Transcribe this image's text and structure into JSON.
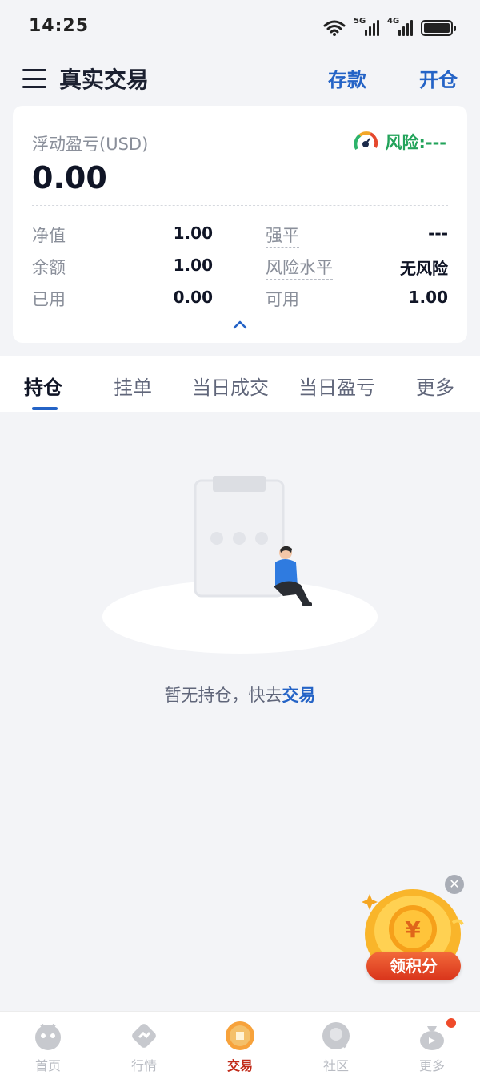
{
  "status_bar": {
    "time": "14:25",
    "network_1": "5G",
    "network_2": "4G"
  },
  "header": {
    "title": "真实交易",
    "deposit_label": "存款",
    "open_label": "开仓"
  },
  "account": {
    "pnl_label": "浮动盈亏(USD)",
    "pnl_value": "0.00",
    "risk_label": "风险:---",
    "metrics": {
      "equity": {
        "label": "净值",
        "value": "1.00"
      },
      "forced": {
        "label": "强平",
        "value": "---"
      },
      "balance": {
        "label": "余额",
        "value": "1.00"
      },
      "risk_level": {
        "label": "风险水平",
        "value": "无风险"
      },
      "used": {
        "label": "已用",
        "value": "0.00"
      },
      "available": {
        "label": "可用",
        "value": "1.00"
      }
    }
  },
  "tabs": [
    {
      "label": "持仓",
      "active": true
    },
    {
      "label": "挂单"
    },
    {
      "label": "当日成交"
    },
    {
      "label": "当日盈亏"
    },
    {
      "label": "更多"
    }
  ],
  "empty_state": {
    "text": "暂无持仓，快去",
    "link": "交易"
  },
  "floating_reward": {
    "label": "领积分",
    "close": "✕",
    "coin_symbol": "¥"
  },
  "bottom_nav": [
    {
      "label": "首页",
      "icon": "home-mascot-icon"
    },
    {
      "label": "行情",
      "icon": "market-icon"
    },
    {
      "label": "交易",
      "icon": "trade-coin-icon",
      "active": true
    },
    {
      "label": "社区",
      "icon": "community-icon"
    },
    {
      "label": "更多",
      "icon": "more-bag-icon",
      "badge": true
    }
  ],
  "colors": {
    "accent": "#2463c6",
    "risk_green": "#22a35a",
    "nav_active": "#c12a18",
    "background": "#f3f4f7"
  }
}
